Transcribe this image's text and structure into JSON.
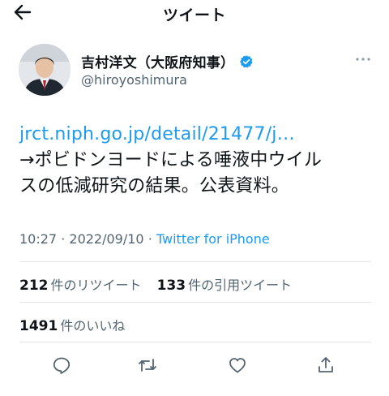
{
  "header": {
    "title": "ツイート",
    "back_icon": "arrow-left-icon"
  },
  "author": {
    "display_name": "吉村洋文（大阪府知事）",
    "handle": "@hiroyoshimura",
    "verified_icon": "verified-badge-icon",
    "more_icon": "more-horizontal-icon"
  },
  "tweet": {
    "link": "jrct.niph.go.jp/detail/21477/j…",
    "text_line1": "→ポビドンヨードによる唾液中ウイル",
    "text_line2": "スの低減研究の結果。公表資料。"
  },
  "meta": {
    "time": "10:27",
    "separator": "·",
    "date": "2022/09/10",
    "source": "Twitter for iPhone"
  },
  "stats": {
    "retweets_count": "212",
    "retweets_label": "件のリツイート",
    "quotes_count": "133",
    "quotes_label": "件の引用ツイート",
    "likes_count": "1491",
    "likes_label": "件のいいね"
  },
  "actions": {
    "reply_icon": "reply-icon",
    "retweet_icon": "retweet-icon",
    "like_icon": "heart-icon",
    "share_icon": "share-icon"
  },
  "colors": {
    "link": "#1d9bf0",
    "text": "#0f1419",
    "secondary": "#536471",
    "divider": "#e1e4e8"
  }
}
